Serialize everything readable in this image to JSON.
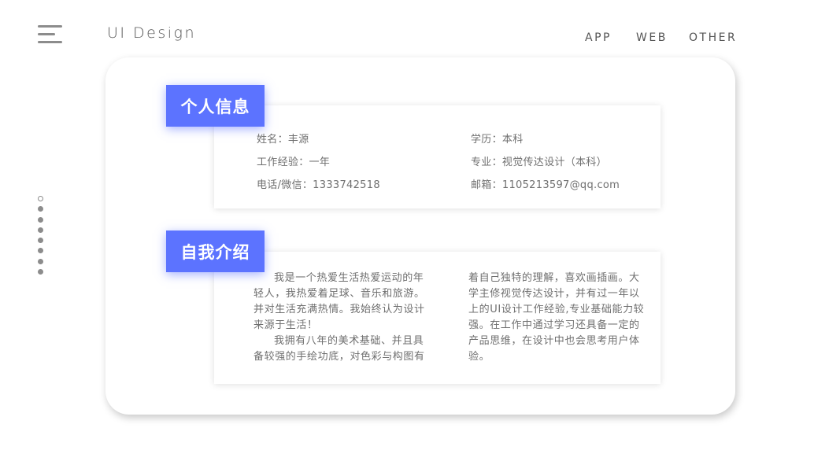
{
  "header": {
    "brand": "UI Design",
    "nav": [
      "APP",
      "WEB",
      "OTHER"
    ]
  },
  "sections": {
    "info": {
      "title": "个人信息",
      "fields": [
        "姓名：丰源",
        "学历：本科",
        "工作经验：一年",
        "专业：视觉传达设计（本科）",
        "电话/微信：1333742518",
        "邮箱：1105213597@qq.com"
      ]
    },
    "intro": {
      "title": "自我介绍",
      "col1": {
        "p1": "我是一个热爱生活热爱运动的年轻人，我热爱着足球、音乐和旅游。并对生活充满热情。我始终认为设计来源于生活！",
        "p2": "我拥有八年的美术基础、并且具备较强的手绘功底，对色彩与构图有"
      },
      "col2": {
        "p1": "着自己独特的理解，喜欢画插画。大学主修视觉传达设计，并有过一年以上的UI设计工作经验,专业基础能力较强。在工作中通过学习还具备一定的产品思维，在设计中也会思考用户体验。"
      }
    }
  },
  "pager": {
    "count": 8,
    "active": 0
  },
  "colors": {
    "accent": "#5c73ff",
    "text": "#6f6f6f",
    "icon": "#8c8c8c"
  }
}
